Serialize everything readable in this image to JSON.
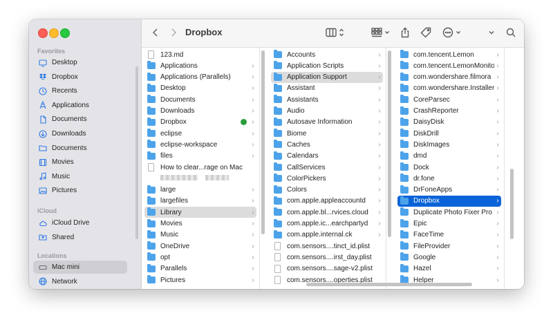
{
  "window": {
    "title": "Dropbox"
  },
  "sidebar": {
    "sections": [
      {
        "label": "Favorites",
        "items": [
          {
            "label": "Desktop",
            "icon": "desktop-icon"
          },
          {
            "label": "Dropbox",
            "icon": "dropbox-icon"
          },
          {
            "label": "Recents",
            "icon": "clock-icon"
          },
          {
            "label": "Applications",
            "icon": "applications-icon"
          },
          {
            "label": "Documents",
            "icon": "document-icon"
          },
          {
            "label": "Downloads",
            "icon": "downloads-icon"
          },
          {
            "label": "Documents",
            "icon": "folder-icon"
          },
          {
            "label": "Movies",
            "icon": "film-icon"
          },
          {
            "label": "Music",
            "icon": "music-icon"
          },
          {
            "label": "Pictures",
            "icon": "photo-icon"
          }
        ]
      },
      {
        "label": "iCloud",
        "items": [
          {
            "label": "iCloud Drive",
            "icon": "cloud-icon"
          },
          {
            "label": "Shared",
            "icon": "shared-folder-icon"
          }
        ]
      },
      {
        "label": "Locations",
        "items": [
          {
            "label": "Mac mini",
            "icon": "computer-icon"
          },
          {
            "label": "Network",
            "icon": "globe-icon"
          }
        ]
      }
    ],
    "selected": "Mac mini"
  },
  "columns": [
    {
      "items": [
        {
          "name": "123.md",
          "kind": "doc"
        },
        {
          "name": "Applications",
          "kind": "folder",
          "arrow": true
        },
        {
          "name": "Applications (Parallels)",
          "kind": "folder",
          "arrow": true
        },
        {
          "name": "Desktop",
          "kind": "folder",
          "arrow": true
        },
        {
          "name": "Documents",
          "kind": "folder",
          "arrow": true
        },
        {
          "name": "Downloads",
          "kind": "folder",
          "arrow": true
        },
        {
          "name": "Dropbox",
          "kind": "folder",
          "arrow": true,
          "synced": true
        },
        {
          "name": "eclipse",
          "kind": "folder",
          "arrow": true
        },
        {
          "name": "eclipse-workspace",
          "kind": "folder",
          "arrow": true
        },
        {
          "name": "files",
          "kind": "folder",
          "arrow": true
        },
        {
          "name": "How to clear...rage on Mac",
          "kind": "doc"
        },
        {
          "name": "",
          "kind": "redacted"
        },
        {
          "name": "large",
          "kind": "folder",
          "arrow": true
        },
        {
          "name": "largefiles",
          "kind": "folder",
          "arrow": true
        },
        {
          "name": "Library",
          "kind": "folder",
          "arrow": true,
          "selected": "gray"
        },
        {
          "name": "Movies",
          "kind": "folder",
          "arrow": true
        },
        {
          "name": "Music",
          "kind": "folder",
          "arrow": true
        },
        {
          "name": "OneDrive",
          "kind": "folder",
          "arrow": true
        },
        {
          "name": "opt",
          "kind": "folder",
          "arrow": true
        },
        {
          "name": "Parallels",
          "kind": "folder",
          "arrow": true
        },
        {
          "name": "Pictures",
          "kind": "folder",
          "arrow": true
        }
      ]
    },
    {
      "items": [
        {
          "name": "Accounts",
          "kind": "folder",
          "arrow": true
        },
        {
          "name": "Application Scripts",
          "kind": "folder",
          "arrow": true
        },
        {
          "name": "Application Support",
          "kind": "folder",
          "arrow": true,
          "selected": "gray"
        },
        {
          "name": "Assistant",
          "kind": "folder",
          "arrow": true
        },
        {
          "name": "Assistants",
          "kind": "folder",
          "arrow": true
        },
        {
          "name": "Audio",
          "kind": "folder",
          "arrow": true
        },
        {
          "name": "Autosave Information",
          "kind": "folder",
          "arrow": true
        },
        {
          "name": "Biome",
          "kind": "folder",
          "arrow": true
        },
        {
          "name": "Caches",
          "kind": "folder",
          "arrow": true
        },
        {
          "name": "Calendars",
          "kind": "folder",
          "arrow": true
        },
        {
          "name": "CallServices",
          "kind": "folder",
          "arrow": true
        },
        {
          "name": "ColorPickers",
          "kind": "folder",
          "arrow": true
        },
        {
          "name": "Colors",
          "kind": "folder",
          "arrow": true
        },
        {
          "name": "com.apple.appleaccountd",
          "kind": "folder",
          "arrow": true
        },
        {
          "name": "com.apple.bl...rvices.cloud",
          "kind": "folder",
          "arrow": true
        },
        {
          "name": "com.apple.ic...earchpartyd",
          "kind": "folder",
          "arrow": true
        },
        {
          "name": "com.apple.internal.ck",
          "kind": "folder",
          "arrow": true
        },
        {
          "name": "com.sensors....tinct_id.plist",
          "kind": "doc"
        },
        {
          "name": "com.sensors....irst_day.plist",
          "kind": "doc"
        },
        {
          "name": "com.sensors....sage-v2.plist",
          "kind": "doc"
        },
        {
          "name": "com.sensors....operties.plist",
          "kind": "doc"
        }
      ]
    },
    {
      "items": [
        {
          "name": "com.tencent.Lemon",
          "kind": "folder",
          "arrow": true
        },
        {
          "name": "com.tencent.LemonMonitor",
          "kind": "folder",
          "arrow": true
        },
        {
          "name": "com.wondershare.filmora",
          "kind": "folder",
          "arrow": true
        },
        {
          "name": "com.wondershare.Installer",
          "kind": "folder",
          "arrow": true
        },
        {
          "name": "CoreParsec",
          "kind": "folder",
          "arrow": true
        },
        {
          "name": "CrashReporter",
          "kind": "folder",
          "arrow": true
        },
        {
          "name": "DaisyDisk",
          "kind": "folder",
          "arrow": true
        },
        {
          "name": "DiskDrill",
          "kind": "folder",
          "arrow": true
        },
        {
          "name": "DiskImages",
          "kind": "folder",
          "arrow": true
        },
        {
          "name": "dmd",
          "kind": "folder",
          "arrow": true
        },
        {
          "name": "Dock",
          "kind": "folder",
          "arrow": true
        },
        {
          "name": "dr.fone",
          "kind": "folder",
          "arrow": true
        },
        {
          "name": "DrFoneApps",
          "kind": "folder",
          "arrow": true
        },
        {
          "name": "Dropbox",
          "kind": "folder",
          "arrow": true,
          "selected": "blue"
        },
        {
          "name": "Duplicate Photo Fixer Pro",
          "kind": "folder",
          "arrow": true
        },
        {
          "name": "Epic",
          "kind": "folder",
          "arrow": true
        },
        {
          "name": "FaceTime",
          "kind": "folder",
          "arrow": true
        },
        {
          "name": "FileProvider",
          "kind": "folder",
          "arrow": true
        },
        {
          "name": "Google",
          "kind": "folder",
          "arrow": true
        },
        {
          "name": "Hazel",
          "kind": "folder",
          "arrow": true
        },
        {
          "name": "Helper",
          "kind": "folder",
          "arrow": true
        }
      ]
    }
  ],
  "colors": {
    "selection_blue": "#0a63d8",
    "folder_blue": "#4da3ea",
    "sync_green": "#2a9d3c"
  }
}
